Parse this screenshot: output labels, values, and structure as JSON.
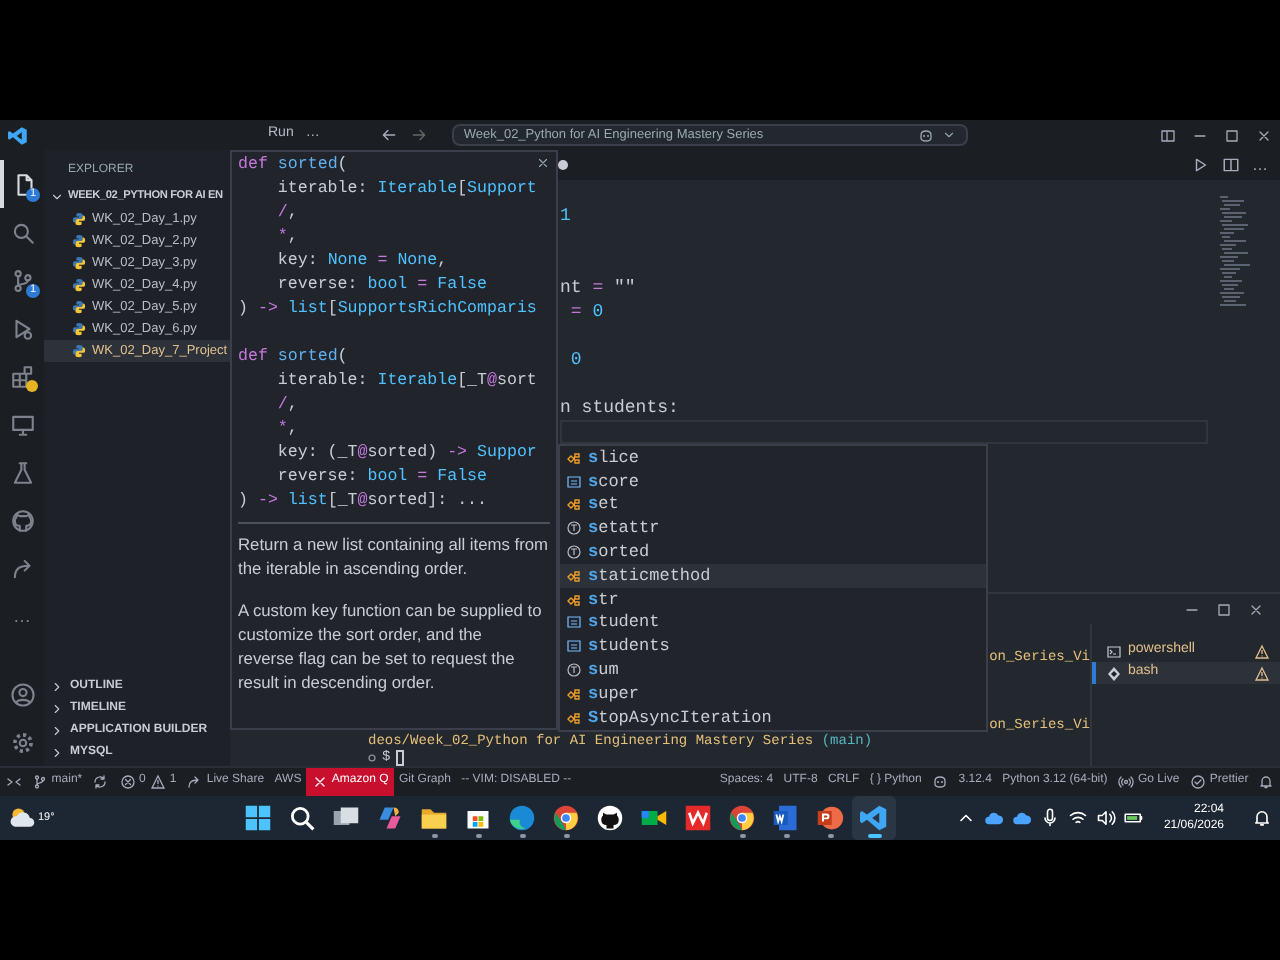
{
  "title_bar": {
    "menu": [
      "Run",
      "…"
    ],
    "command_center": "Week_02_Python for AI Engineering Mastery Series"
  },
  "activity_bar": {
    "items": [
      {
        "kind": "explorer",
        "selected": true,
        "badge": "1",
        "alert": false
      },
      {
        "kind": "search",
        "selected": false,
        "alert": false
      },
      {
        "kind": "source-control",
        "selected": false,
        "badge": "1",
        "alert": false
      },
      {
        "kind": "run-debug",
        "selected": false,
        "alert": false
      },
      {
        "kind": "extensions",
        "selected": false,
        "alert": true
      },
      {
        "kind": "remote-explorer",
        "selected": false,
        "alert": false
      },
      {
        "kind": "testing",
        "selected": false,
        "alert": false
      },
      {
        "kind": "github",
        "selected": false,
        "alert": false
      },
      {
        "kind": "live-share",
        "selected": false,
        "alert": false
      },
      {
        "kind": "more",
        "label": "…",
        "selected": false,
        "alert": false
      }
    ],
    "bottom": [
      {
        "kind": "account"
      },
      {
        "kind": "settings"
      }
    ]
  },
  "sidebar": {
    "title": "EXPLORER",
    "folder": {
      "name": "WEEK_02_PYTHON FOR AI EN",
      "expanded": true,
      "children": [
        {
          "name": "WK_02_Day_1.py",
          "selected": false,
          "modified": false
        },
        {
          "name": "WK_02_Day_2.py",
          "selected": false,
          "modified": false
        },
        {
          "name": "WK_02_Day_3.py",
          "selected": false,
          "modified": false
        },
        {
          "name": "WK_02_Day_4.py",
          "selected": false,
          "modified": false
        },
        {
          "name": "WK_02_Day_5.py",
          "selected": false,
          "modified": false
        },
        {
          "name": "WK_02_Day_6.py",
          "selected": false,
          "modified": false
        },
        {
          "name": "WK_02_Day_7_Project",
          "selected": true,
          "modified": true
        }
      ]
    },
    "sections": [
      {
        "label": "OUTLINE",
        "expanded": false
      },
      {
        "label": "TIMELINE",
        "expanded": false
      },
      {
        "label": "APPLICATION BUILDER",
        "expanded": false
      },
      {
        "label": "MYSQL",
        "expanded": false
      }
    ]
  },
  "editor": {
    "tab": {
      "dirty": true
    },
    "actions": [
      {
        "kind": "run"
      },
      {
        "kind": "split"
      },
      {
        "kind": "more",
        "label": "…"
      }
    ],
    "lines": [
      {
        "kind": "code",
        "text": "1"
      },
      {
        "kind": "blank"
      },
      {
        "kind": "blank"
      },
      {
        "kind": "code",
        "text": "nt = \"\""
      },
      {
        "kind": "code",
        "text": " = 0"
      },
      {
        "kind": "blank"
      },
      {
        "kind": "code",
        "text": " 0"
      },
      {
        "kind": "blank"
      },
      {
        "kind": "code",
        "text": "n students:"
      },
      {
        "kind": "cursor"
      }
    ],
    "hover": {
      "signatures": [
        [
          "def sorted(",
          "    iterable: Iterable[Support",
          "    /,",
          "    *,",
          "    key: None = None,",
          "    reverse: bool = False",
          ") -> list[SupportsRichComparis"
        ],
        [
          "def sorted(",
          "    iterable: Iterable[_T@sort",
          "    /,",
          "    *,",
          "    key: (_T@sorted) -> Suppor",
          "    reverse: bool = False",
          ") -> list[_T@sorted]: ..."
        ]
      ],
      "docs": [
        [
          "Return a new list containing all items from the iterable in ascending order."
        ],
        [
          "A custom key function can be supplied to customize the sort order, and the",
          "reverse flag can be set to request the result in descending order."
        ]
      ]
    },
    "suggestions": [
      {
        "kind": "class",
        "match": "s",
        "rest": "lice",
        "selected": false
      },
      {
        "kind": "variable",
        "match": "s",
        "rest": "core",
        "selected": false
      },
      {
        "kind": "class",
        "match": "s",
        "rest": "et",
        "selected": false
      },
      {
        "kind": "function",
        "match": "s",
        "rest": "etattr",
        "selected": false
      },
      {
        "kind": "function",
        "match": "s",
        "rest": "orted",
        "selected": false
      },
      {
        "kind": "class",
        "match": "s",
        "rest": "taticmethod",
        "selected": true
      },
      {
        "kind": "class",
        "match": "s",
        "rest": "tr",
        "selected": false
      },
      {
        "kind": "variable",
        "match": "s",
        "rest": "tudent",
        "selected": false
      },
      {
        "kind": "variable",
        "match": "s",
        "rest": "tudents",
        "selected": false
      },
      {
        "kind": "function",
        "match": "s",
        "rest": "um",
        "selected": false
      },
      {
        "kind": "class",
        "match": "s",
        "rest": "uper",
        "selected": false
      },
      {
        "kind": "class",
        "match": "S",
        "rest": "topAsyncIteration",
        "selected": false
      }
    ]
  },
  "panel": {
    "terminal": {
      "earlier_output": [
        "on_Series_Vi"
      ],
      "latest_output": [
        "on_Series_Vi"
      ],
      "prompt": {
        "path": "deos/Week_02_Python for AI Engineering Mastery Series",
        "branch": "(main)"
      },
      "input": "$"
    },
    "terminals": [
      {
        "name": "powershell",
        "kind": "powershell",
        "selected": false,
        "warning": true
      },
      {
        "name": "bash",
        "kind": "bash",
        "selected": true,
        "warning": true
      }
    ]
  },
  "status_bar": {
    "left": [
      {
        "kind": "remote"
      },
      {
        "kind": "branch",
        "text": "main*"
      },
      {
        "kind": "sync"
      },
      {
        "kind": "problems",
        "errors": "0",
        "warnings": "1"
      },
      {
        "kind": "live-share",
        "text": "Live Share"
      },
      {
        "kind": "plain",
        "text": "AWS"
      },
      {
        "kind": "error",
        "text": "Amazon Q"
      },
      {
        "kind": "plain",
        "text": "Git Graph"
      },
      {
        "kind": "plain",
        "text": "-- VIM: DISABLED --"
      }
    ],
    "right": [
      {
        "kind": "plain",
        "text": "Spaces: 4"
      },
      {
        "kind": "plain",
        "text": "UTF-8"
      },
      {
        "kind": "plain",
        "text": "CRLF"
      },
      {
        "kind": "plain",
        "text": "{ } Python"
      },
      {
        "kind": "copilot"
      },
      {
        "kind": "plain",
        "text": "3.12.4"
      },
      {
        "kind": "plain",
        "text": "Python 3.12 (64-bit)"
      },
      {
        "kind": "go-live",
        "text": "Go Live"
      },
      {
        "kind": "prettier",
        "text": "Prettier"
      },
      {
        "kind": "bell"
      }
    ]
  },
  "taskbar": {
    "weather": "19°",
    "apps": [
      {
        "kind": "start",
        "running": false,
        "active": false
      },
      {
        "kind": "search",
        "running": false,
        "active": false
      },
      {
        "kind": "task-view",
        "running": false,
        "active": false
      },
      {
        "kind": "copilot",
        "running": false,
        "active": false
      },
      {
        "kind": "file-explorer",
        "running": true,
        "active": false
      },
      {
        "kind": "store",
        "running": true,
        "active": false
      },
      {
        "kind": "edge",
        "running": true,
        "active": false
      },
      {
        "kind": "chrome",
        "running": true,
        "active": false
      },
      {
        "kind": "github",
        "running": false,
        "active": false
      },
      {
        "kind": "meet",
        "running": false,
        "active": false
      },
      {
        "kind": "wps",
        "running": false,
        "active": false
      },
      {
        "kind": "chrome",
        "running": true,
        "active": false
      },
      {
        "kind": "word",
        "running": true,
        "active": false
      },
      {
        "kind": "powerpoint",
        "running": true,
        "active": false
      },
      {
        "kind": "vscode",
        "running": true,
        "active": true
      }
    ],
    "tray": [
      {
        "kind": "chevron-up"
      },
      {
        "kind": "cloud"
      },
      {
        "kind": "cloud"
      },
      {
        "kind": "mic"
      },
      {
        "kind": "wifi"
      },
      {
        "kind": "volume"
      },
      {
        "kind": "battery"
      }
    ],
    "time": "22:04",
    "date": "21/06/2026"
  }
}
